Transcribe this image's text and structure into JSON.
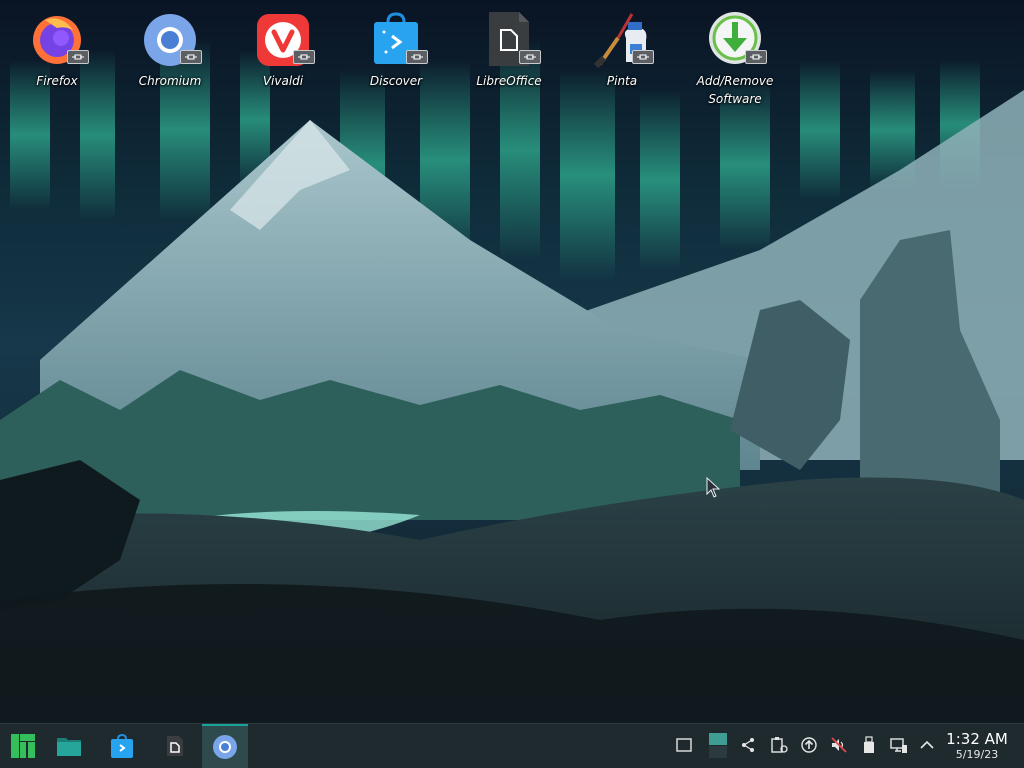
{
  "desktop": {
    "icons": [
      {
        "label": "Firefox",
        "icon": "firefox-icon"
      },
      {
        "label": "Chromium",
        "icon": "chromium-icon"
      },
      {
        "label": "Vivaldi",
        "icon": "vivaldi-icon"
      },
      {
        "label": "Discover",
        "icon": "discover-icon"
      },
      {
        "label": "LibreOffice",
        "icon": "libreoffice-icon"
      },
      {
        "label": "Pinta",
        "icon": "pinta-icon"
      },
      {
        "label": "Add/Remove\nSoftware",
        "icon": "add-remove-software-icon"
      }
    ]
  },
  "taskbar": {
    "launchers": [
      {
        "name": "manjaro-menu-icon"
      },
      {
        "name": "file-manager-icon"
      },
      {
        "name": "discover-icon"
      },
      {
        "name": "libreoffice-icon"
      },
      {
        "name": "chromium-icon",
        "active": true
      }
    ],
    "tray": [
      {
        "name": "show-desktop-icon"
      },
      {
        "name": "virtual-desktop-pager-icon"
      },
      {
        "name": "kde-connect-icon"
      },
      {
        "name": "clipboard-icon"
      },
      {
        "name": "updates-icon"
      },
      {
        "name": "volume-muted-icon"
      },
      {
        "name": "removable-devices-icon"
      },
      {
        "name": "network-icon"
      },
      {
        "name": "tray-expand-icon"
      }
    ],
    "clock": {
      "time": "1:32 AM",
      "date": "5/19/23"
    }
  },
  "colors": {
    "taskbar_bg": "#1f2a2e",
    "accent": "#1aa39a",
    "aurora": "#3de2b4"
  }
}
